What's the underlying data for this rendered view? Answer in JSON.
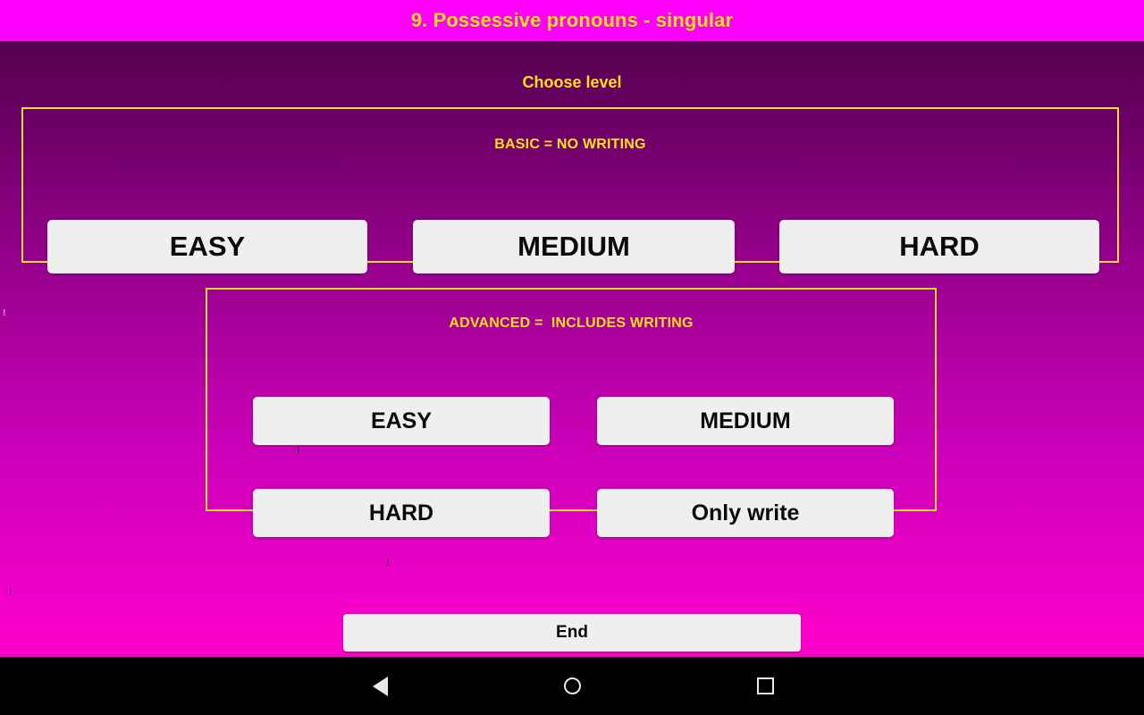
{
  "window": {
    "title": "9. Possessive pronouns - singular"
  },
  "colors": {
    "titlebar_bg": "#FF00FF",
    "title_text": "#FFE01B",
    "accent_border": "#FFDD33",
    "gradient_top": "#560050",
    "gradient_bottom": "#FF00CC",
    "button_bg": "#EFEFF0",
    "button_text": "#0A0A0A",
    "navbar_bg": "#000000"
  },
  "main": {
    "heading": "Choose level",
    "groups": [
      {
        "title": "BASIC = NO WRITING",
        "buttons": [
          {
            "label": "EASY"
          },
          {
            "label": "MEDIUM"
          },
          {
            "label": "HARD"
          }
        ]
      },
      {
        "title": "ADVANCED =  INCLUDES WRITING",
        "buttons": [
          {
            "label": "EASY"
          },
          {
            "label": "MEDIUM"
          },
          {
            "label": "HARD"
          },
          {
            "label": "Only write"
          }
        ]
      }
    ],
    "end_button": {
      "label": "End"
    }
  },
  "artifacts": [
    {
      "text": "!"
    },
    {
      "text": "!"
    },
    {
      "text": "!"
    },
    {
      "text": "!"
    }
  ],
  "navbar": {
    "back": "back-icon",
    "home": "home-icon",
    "recent": "recent-apps-icon"
  }
}
